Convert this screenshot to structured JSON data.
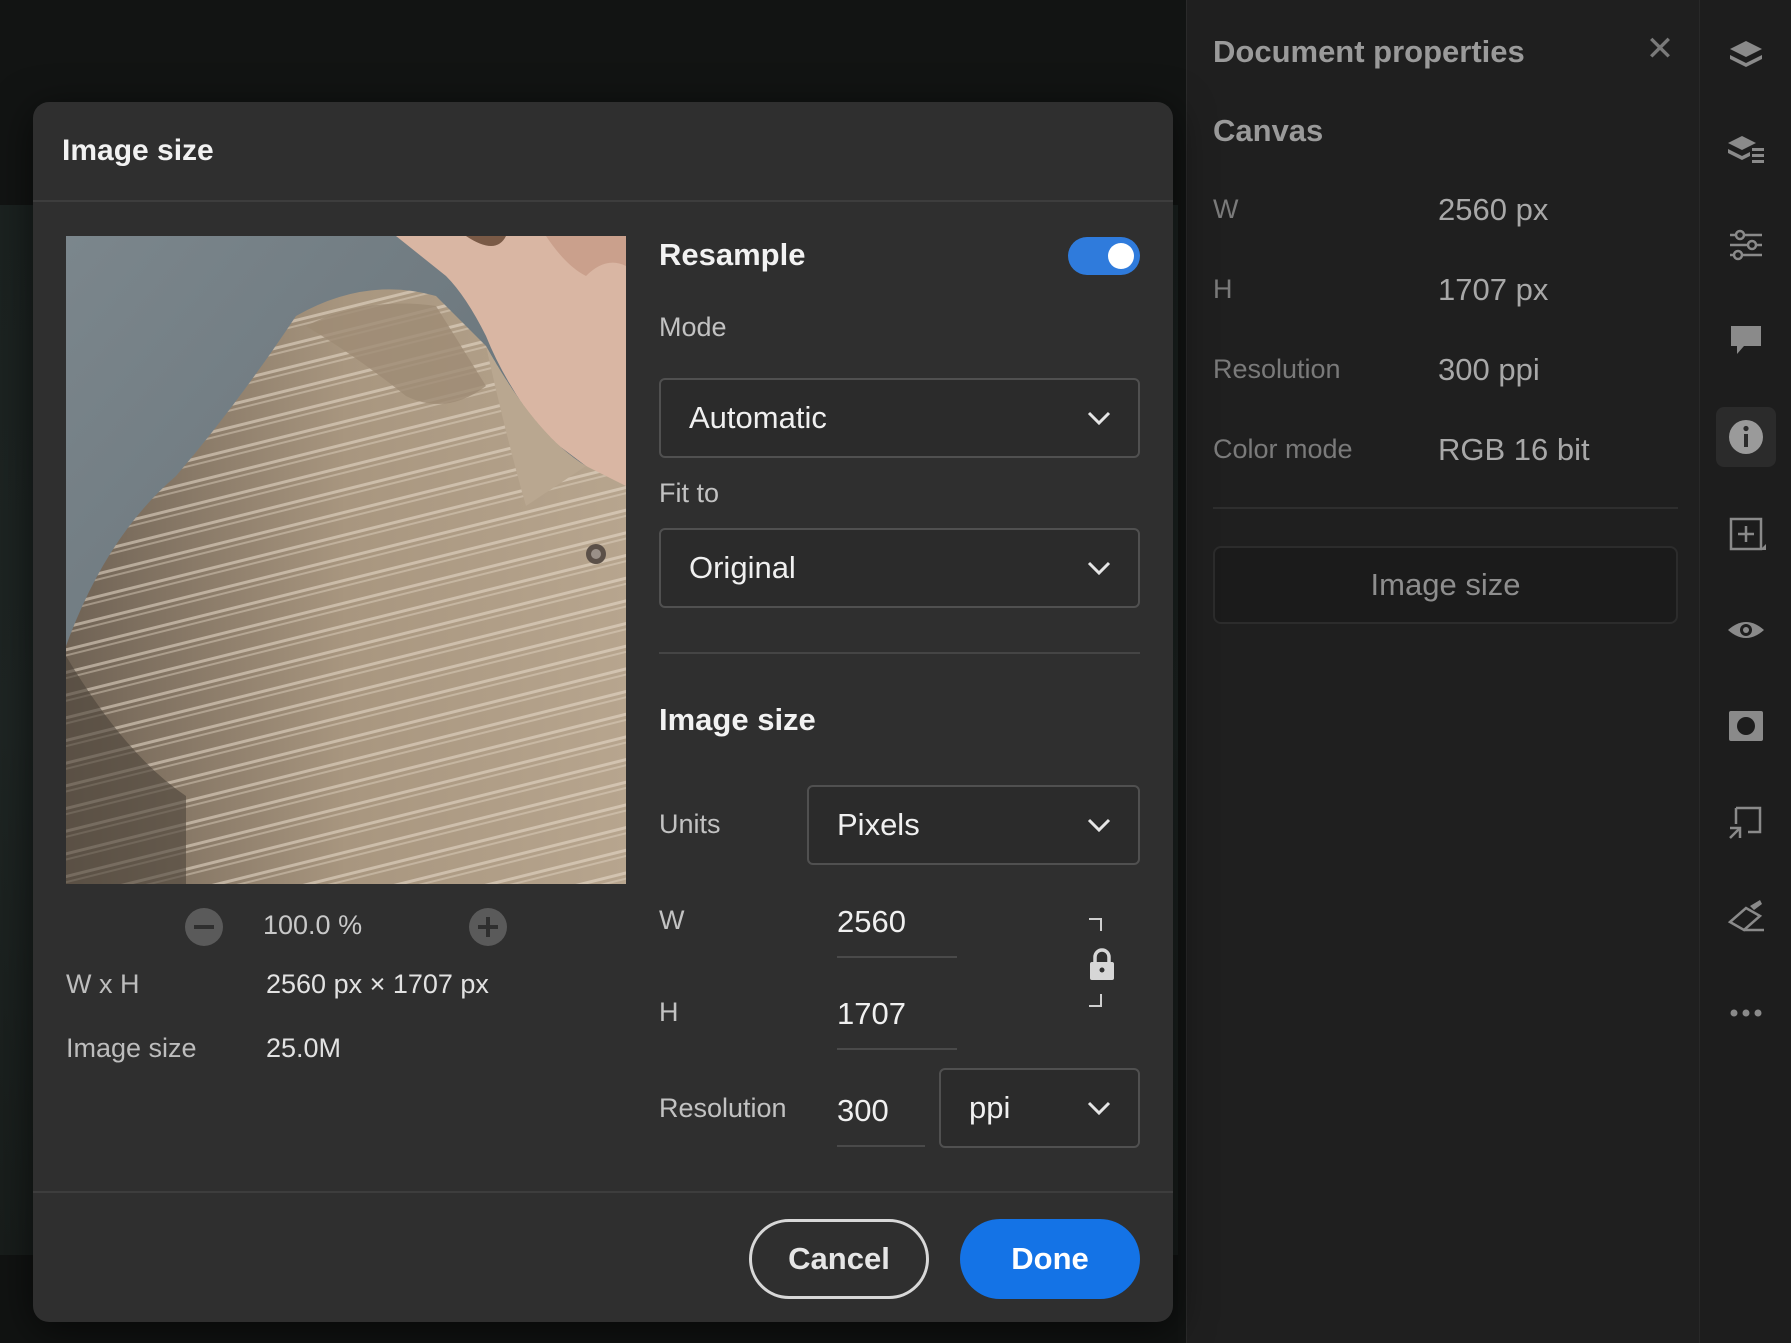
{
  "right_panel": {
    "title": "Document properties",
    "section": "Canvas",
    "rows": [
      {
        "label": "W",
        "value": "2560 px"
      },
      {
        "label": "H",
        "value": "1707 px"
      },
      {
        "label": "Resolution",
        "value": "300 ppi"
      },
      {
        "label": "Color mode",
        "value": "RGB  16 bit"
      }
    ],
    "image_size_button": "Image size"
  },
  "rail_icons": [
    "layers-icon",
    "layer-properties-icon",
    "adjustments-icon",
    "comments-icon",
    "info-icon",
    "add-layer-icon",
    "visibility-icon",
    "mask-icon",
    "transform-icon",
    "eraser-icon",
    "more-icon"
  ],
  "dialog": {
    "title": "Image size",
    "zoom": "100.0 %",
    "info": [
      {
        "label": "W x H",
        "value": "2560 px  ×  1707 px"
      },
      {
        "label": "Image size",
        "value": "25.0M"
      }
    ],
    "resample": {
      "label": "Resample",
      "enabled": true
    },
    "mode": {
      "label": "Mode",
      "value": "Automatic"
    },
    "fit_to": {
      "label": "Fit to",
      "value": "Original"
    },
    "image_size_section": "Image size",
    "units": {
      "label": "Units",
      "value": "Pixels"
    },
    "width": {
      "label": "W",
      "value": "2560"
    },
    "height": {
      "label": "H",
      "value": "1707"
    },
    "resolution": {
      "label": "Resolution",
      "value": "300",
      "unit": "ppi"
    },
    "cancel": "Cancel",
    "done": "Done"
  },
  "colors": {
    "accent": "#1473e6",
    "toggle": "#2f7bdc",
    "dialog_bg": "#2f2f2f",
    "panel_bg": "#1f1f1f"
  }
}
